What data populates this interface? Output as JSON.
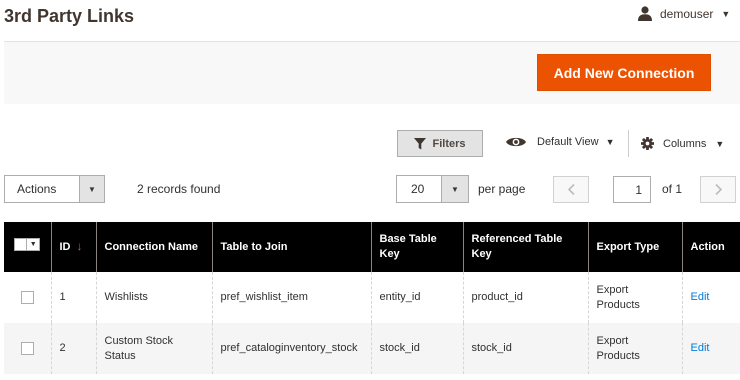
{
  "page": {
    "title": "3rd Party Links"
  },
  "user": {
    "name": "demouser",
    "icon": "user-icon"
  },
  "toolbar": {
    "add_button": "Add New Connection"
  },
  "grid_controls": {
    "filters_label": "Filters",
    "view_label": "Default View",
    "columns_label": "Columns",
    "actions_label": "Actions",
    "records_found": "2 records found",
    "page_size": "20",
    "per_page_label": "per page",
    "current_page": "1",
    "of_total": "of 1"
  },
  "table": {
    "columns": [
      "ID",
      "Connection Name",
      "Table to Join",
      "Base Table Key",
      "Referenced Table Key",
      "Export Type",
      "Action"
    ],
    "sorted_column": "ID",
    "sort_arrow": "↓",
    "rows": [
      {
        "id": "1",
        "connection_name": "Wishlists",
        "table_to_join": "pref_wishlist_item",
        "base_key": "entity_id",
        "ref_key": "product_id",
        "export_type": "Export Products",
        "action": "Edit"
      },
      {
        "id": "2",
        "connection_name": "Custom Stock Status",
        "table_to_join": "pref_cataloginventory_stock",
        "base_key": "stock_id",
        "ref_key": "stock_id",
        "export_type": "Export Products",
        "action": "Edit"
      }
    ]
  },
  "colors": {
    "accent": "#eb5202",
    "header_bg": "#000000",
    "link": "#007bdb"
  }
}
